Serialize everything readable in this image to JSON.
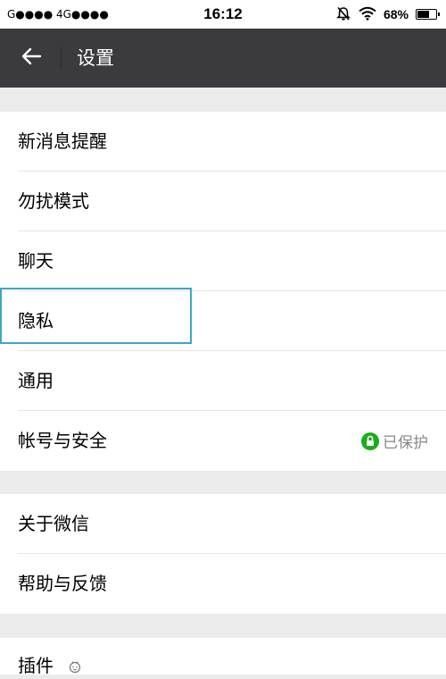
{
  "status_bar": {
    "carrier_text": "G●●●● 4G●●●●",
    "time": "16:12",
    "battery_percent": "68%",
    "battery_level": 0.68
  },
  "header": {
    "title": "设置",
    "back_icon": "arrow-left-icon"
  },
  "groups": [
    {
      "items": [
        {
          "label": "新消息提醒"
        },
        {
          "label": "勿扰模式"
        },
        {
          "label": "聊天"
        },
        {
          "label": "隐私"
        },
        {
          "label": "通用"
        },
        {
          "label": "帐号与安全",
          "status": "已保护"
        }
      ]
    },
    {
      "items": [
        {
          "label": "关于微信"
        },
        {
          "label": "帮助与反馈"
        }
      ]
    },
    {
      "items": [
        {
          "label": "插件"
        }
      ]
    }
  ],
  "colors": {
    "header_bg": "#3b3b3f",
    "page_bg": "#ebebeb",
    "protected_badge": "#1aad19",
    "highlight_border": "#3fa6c6"
  }
}
